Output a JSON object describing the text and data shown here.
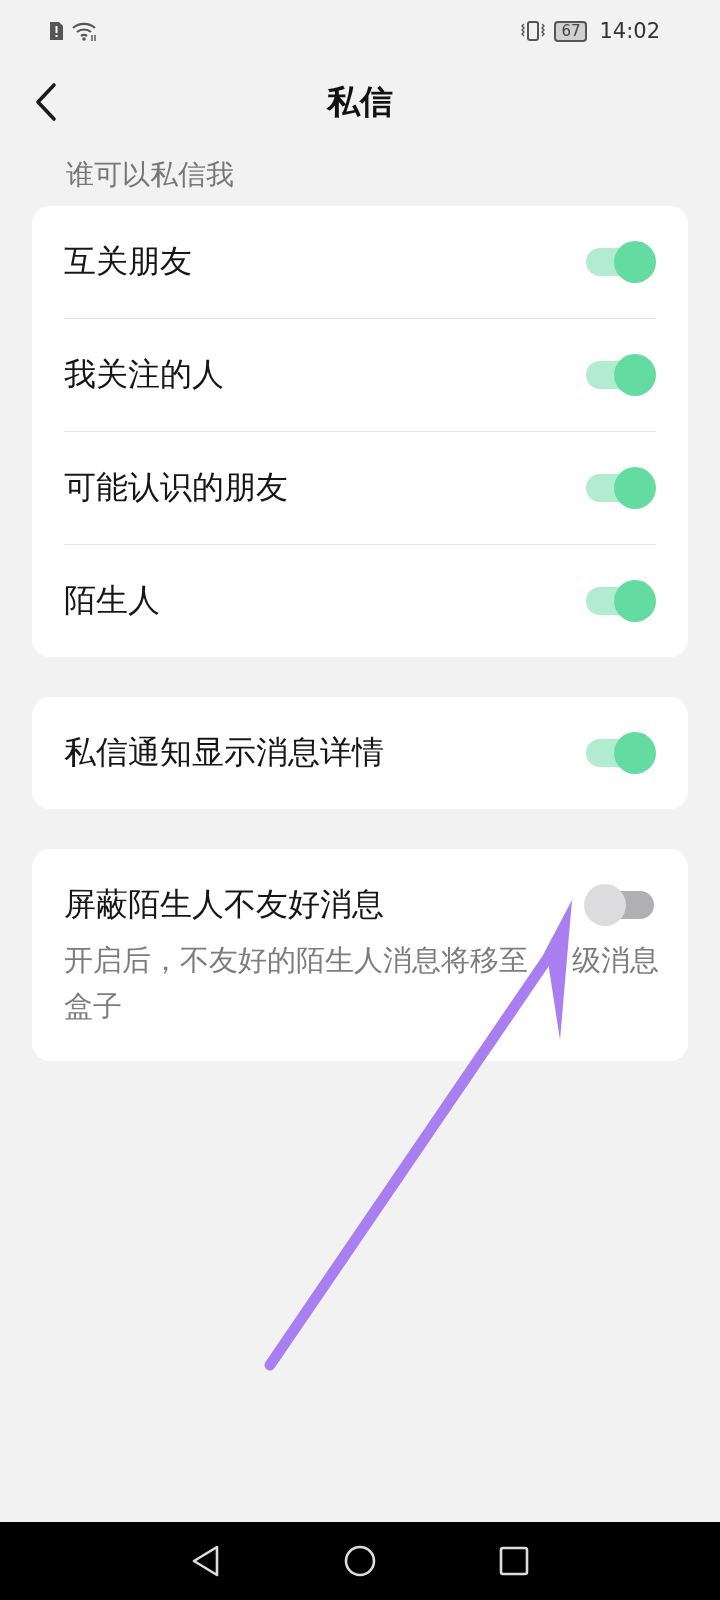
{
  "status_bar": {
    "battery": "67",
    "time": "14:02"
  },
  "header": {
    "title": "私信"
  },
  "sections": [
    {
      "label": "谁可以私信我",
      "items": [
        {
          "title": "互关朋友",
          "on": true
        },
        {
          "title": "我关注的人",
          "on": true
        },
        {
          "title": "可能认识的朋友",
          "on": true
        },
        {
          "title": "陌生人",
          "on": true
        }
      ]
    },
    {
      "items": [
        {
          "title": "私信通知显示消息详情",
          "on": true
        }
      ]
    },
    {
      "items": [
        {
          "title": "屏蔽陌生人不友好消息",
          "on": false,
          "description": [
            "开启后，不友好的陌生人消息将移至",
            "级消息盒子"
          ]
        }
      ]
    }
  ]
}
